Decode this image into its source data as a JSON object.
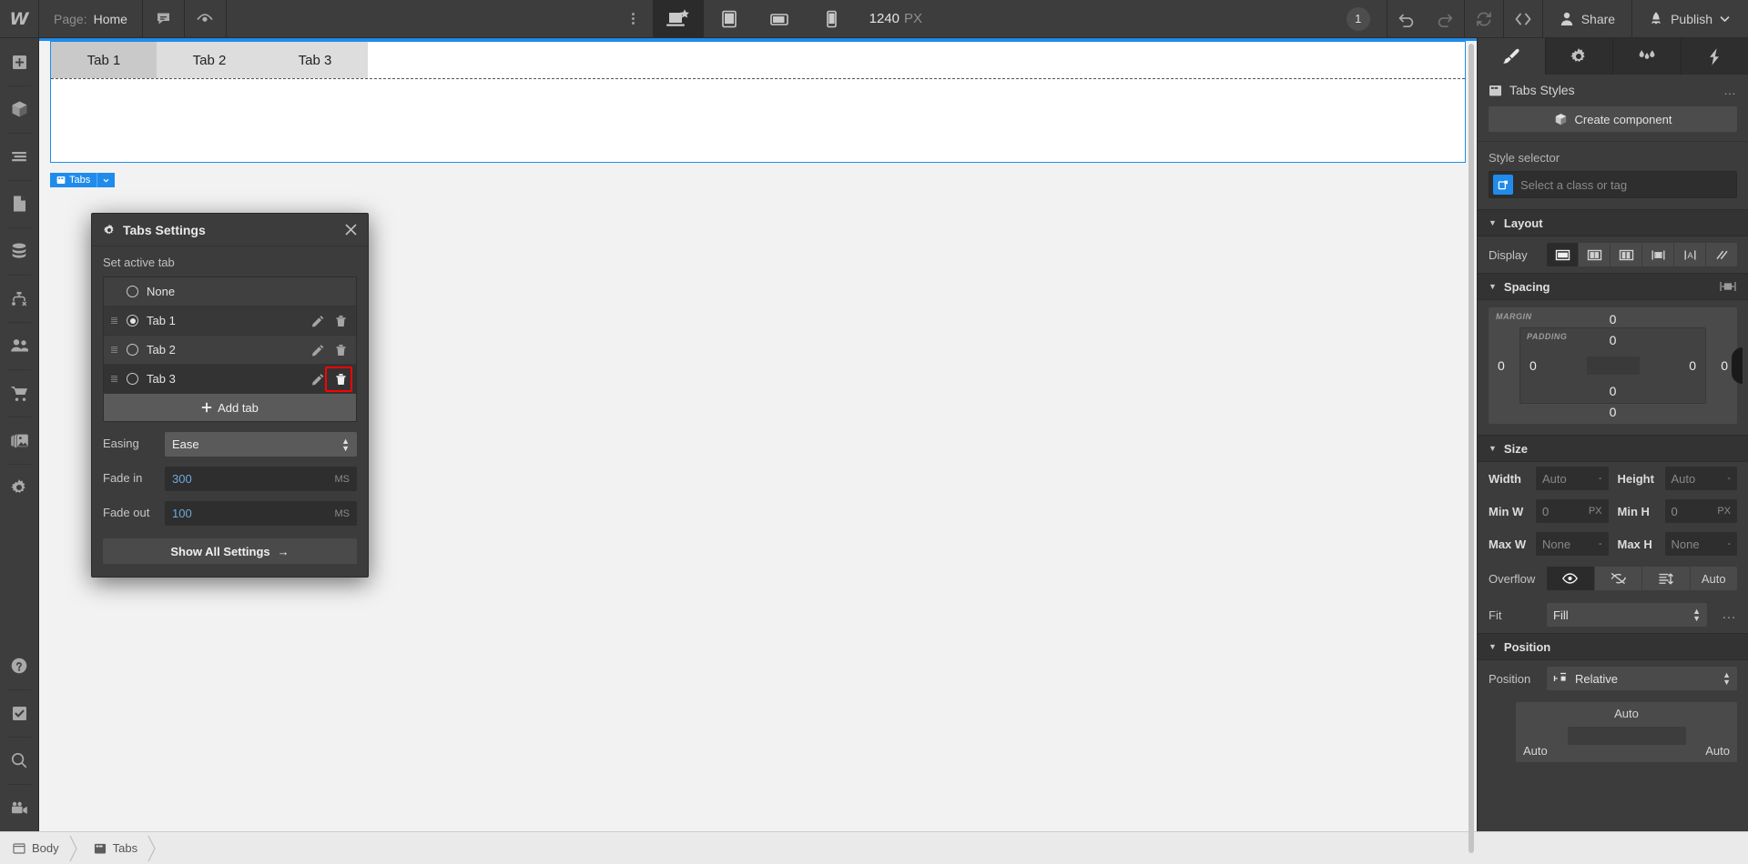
{
  "topbar": {
    "logo": "W",
    "page_label": "Page:",
    "page_name": "Home",
    "comments_icon": "comment-icon",
    "preview_icon": "eye-icon",
    "kebab_icon": "more-vertical-icon",
    "viewports": [
      {
        "name": "desktop-viewport",
        "icon": "desktop-star-icon",
        "active": true
      },
      {
        "name": "tablet-viewport",
        "icon": "tablet-icon",
        "active": false
      },
      {
        "name": "mobile-landscape-viewport",
        "icon": "mobile-landscape-icon",
        "active": false
      },
      {
        "name": "mobile-portrait-viewport",
        "icon": "mobile-portrait-icon",
        "active": false
      }
    ],
    "canvas_width": "1240",
    "canvas_unit": "PX",
    "breakpoint_count": "1",
    "undo_icon": "undo-icon",
    "redo_icon": "redo-icon",
    "sync_icon": "refresh-icon",
    "code_icon": "code-brackets-icon",
    "share_label": "Share",
    "publish_label": "Publish"
  },
  "leftrail": {
    "items": [
      {
        "name": "add-elements",
        "icon": "plus-square-icon"
      },
      {
        "name": "components",
        "icon": "cube-icon"
      },
      {
        "name": "navigator",
        "icon": "layers-list-icon"
      },
      {
        "name": "pages",
        "icon": "page-icon"
      },
      {
        "name": "cms",
        "icon": "database-icon"
      },
      {
        "name": "logic",
        "icon": "logic-flow-icon"
      },
      {
        "name": "users",
        "icon": "users-icon"
      },
      {
        "name": "ecommerce",
        "icon": "cart-icon"
      },
      {
        "name": "assets",
        "icon": "images-icon"
      },
      {
        "name": "settings",
        "icon": "gear-icon"
      }
    ],
    "bottom_items": [
      {
        "name": "help",
        "icon": "question-circle-icon"
      },
      {
        "name": "audit",
        "icon": "checkbox-check-icon"
      },
      {
        "name": "search",
        "icon": "search-icon"
      },
      {
        "name": "video-tutorials",
        "icon": "video-camera-icon"
      }
    ]
  },
  "canvas": {
    "tabs": [
      {
        "label": "Tab 1",
        "current": true
      },
      {
        "label": "Tab 2",
        "current": false
      },
      {
        "label": "Tab 3",
        "current": false
      }
    ],
    "selection_badge": "Tabs",
    "selection_badge_icon": "tabs-icon",
    "selection_color": "#1f8ceb"
  },
  "breadcrumb": {
    "items": [
      {
        "label": "Body",
        "icon": "body-icon"
      },
      {
        "label": "Tabs",
        "icon": "tabs-icon"
      }
    ]
  },
  "popover": {
    "title": "Tabs Settings",
    "title_icon": "gear-icon",
    "close_icon": "close-icon",
    "set_active_label": "Set active tab",
    "options": [
      {
        "label": "None",
        "selected": false,
        "draggable": false,
        "actions": false
      },
      {
        "label": "Tab 1",
        "selected": true,
        "draggable": true,
        "actions": true
      },
      {
        "label": "Tab 2",
        "selected": false,
        "draggable": true,
        "actions": true
      },
      {
        "label": "Tab 3",
        "selected": false,
        "draggable": true,
        "actions": true
      }
    ],
    "add_tab_label": "Add tab",
    "add_tab_icon": "plus-icon",
    "edit_icon": "pencil-icon",
    "delete_icon": "trash-icon",
    "highlight_color": "#ff0000",
    "easing_label": "Easing",
    "easing_value": "Ease",
    "fade_in_label": "Fade in",
    "fade_in_value": "300",
    "fade_in_unit": "MS",
    "fade_out_label": "Fade out",
    "fade_out_value": "100",
    "fade_out_unit": "MS",
    "show_all_label": "Show All Settings",
    "show_all_arrow": "→"
  },
  "rightpanel": {
    "tabs": [
      {
        "name": "style-panel-tab",
        "icon": "paintbrush-icon",
        "active": true
      },
      {
        "name": "settings-panel-tab",
        "icon": "gear-icon",
        "active": false
      },
      {
        "name": "interactions-panel-tab",
        "icon": "droplets-icon",
        "active": false
      },
      {
        "name": "effects-panel-tab",
        "icon": "lightning-icon",
        "active": false
      }
    ],
    "selector_title": "Tabs Styles",
    "selector_title_icon": "tabs-icon",
    "selector_more": "…",
    "create_component_label": "Create component",
    "create_component_icon": "cube-icon",
    "style_selector_label": "Style selector",
    "style_selector_placeholder": "Select a class or tag",
    "style_selector_icon": "element-tag-icon",
    "layout": {
      "title": "Layout",
      "display_label": "Display",
      "display_options": [
        {
          "name": "display-block",
          "icon": "block-icon",
          "active": true
        },
        {
          "name": "display-flex",
          "icon": "flex-icon",
          "active": false
        },
        {
          "name": "display-grid",
          "icon": "grid-icon",
          "active": false
        },
        {
          "name": "display-inline-block",
          "icon": "inline-block-icon",
          "active": false
        },
        {
          "name": "display-inline",
          "icon": "inline-icon",
          "active": false
        },
        {
          "name": "display-none",
          "icon": "none-icon",
          "active": false
        }
      ]
    },
    "spacing": {
      "title": "Spacing",
      "more_icon": "spacing-options-icon",
      "margin_label": "MARGIN",
      "padding_label": "PADDING",
      "margin_top": "0",
      "margin_bottom": "0",
      "margin_left": "0",
      "margin_right": "0",
      "padding_top": "0",
      "padding_bottom": "0",
      "padding_left": "0",
      "padding_right": "0"
    },
    "size": {
      "title": "Size",
      "width_label": "Width",
      "width_value": "Auto",
      "width_unit": "-",
      "height_label": "Height",
      "height_value": "Auto",
      "height_unit": "-",
      "min_w_label": "Min W",
      "min_w_value": "0",
      "min_w_unit": "PX",
      "min_h_label": "Min H",
      "min_h_value": "0",
      "min_h_unit": "PX",
      "max_w_label": "Max W",
      "max_w_value": "None",
      "max_w_unit": "-",
      "max_h_label": "Max H",
      "max_h_value": "None",
      "max_h_unit": "-",
      "overflow_label": "Overflow",
      "overflow_options": [
        {
          "name": "overflow-visible",
          "icon": "eye-icon",
          "active": true,
          "text": ""
        },
        {
          "name": "overflow-hidden",
          "icon": "eye-off-icon",
          "active": false,
          "text": ""
        },
        {
          "name": "overflow-scroll",
          "icon": "scroll-icon",
          "active": false,
          "text": ""
        },
        {
          "name": "overflow-auto",
          "icon": "",
          "active": false,
          "text": "Auto"
        }
      ],
      "fit_label": "Fit",
      "fit_value": "Fill",
      "fit_more": "…"
    },
    "position": {
      "title": "Position",
      "position_label": "Position",
      "position_value": "Relative",
      "position_icon": "position-relative-icon",
      "top_value": "Auto",
      "left_value": "Auto",
      "right_value": "Auto"
    }
  }
}
